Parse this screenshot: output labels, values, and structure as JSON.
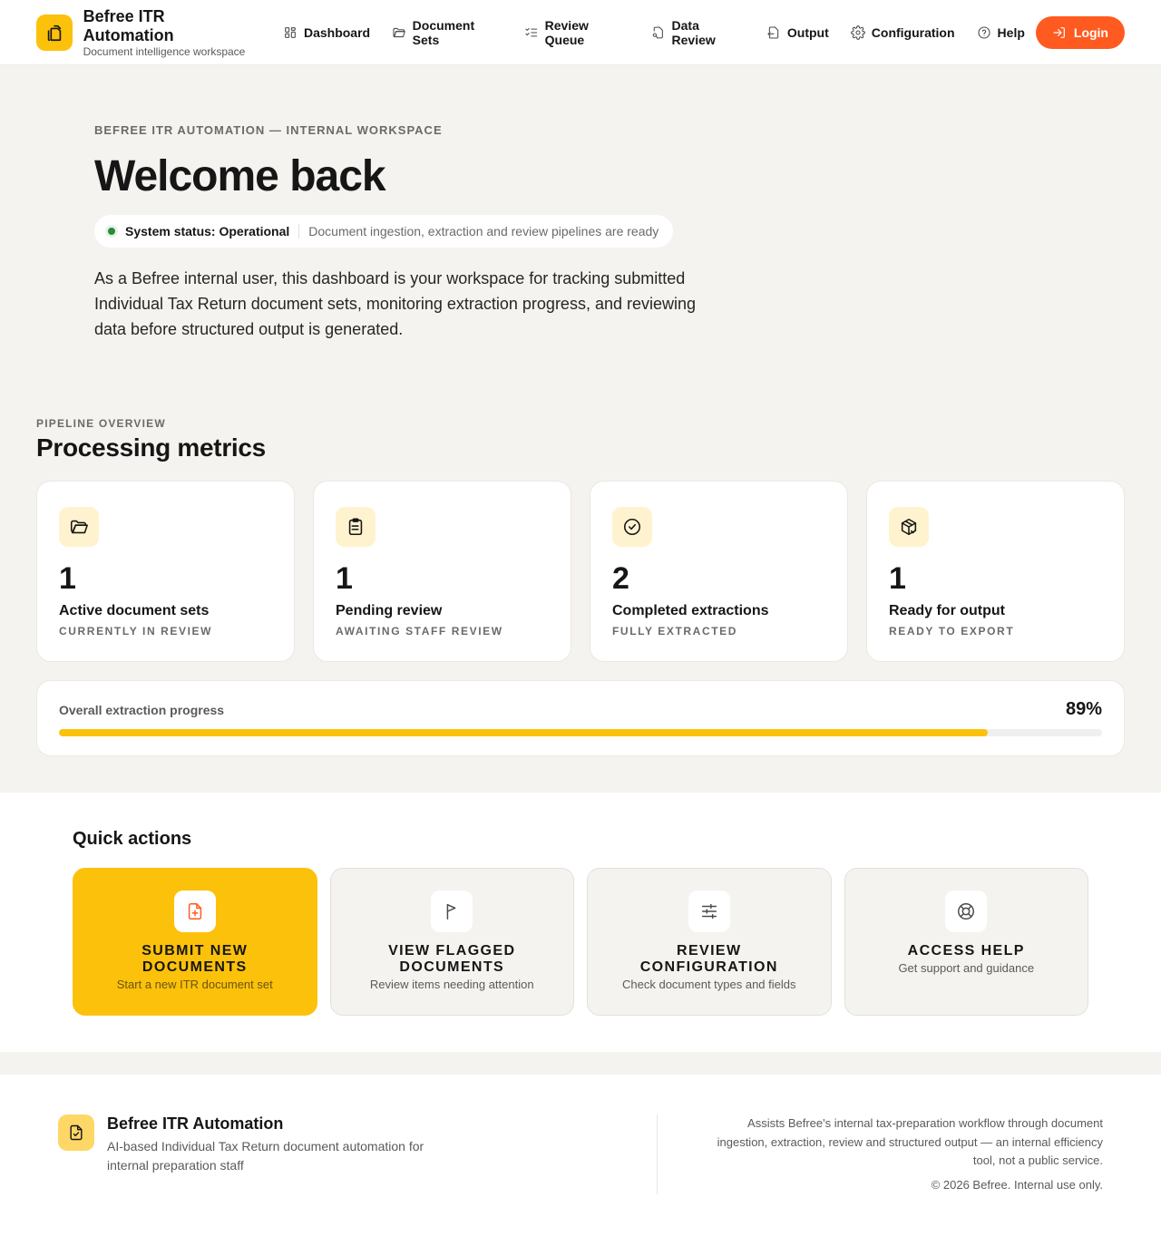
{
  "header": {
    "brand_title": "Befree ITR Automation",
    "brand_subtitle": "Document intelligence workspace",
    "nav": [
      {
        "label": "Dashboard",
        "icon": "dashboard-icon"
      },
      {
        "label": "Document Sets",
        "icon": "folder-icon"
      },
      {
        "label": "Review Queue",
        "icon": "list-check-icon"
      },
      {
        "label": "Data Review",
        "icon": "file-search-icon"
      },
      {
        "label": "Output",
        "icon": "file-export-icon"
      },
      {
        "label": "Configuration",
        "icon": "gear-icon"
      },
      {
        "label": "Help",
        "icon": "help-circle-icon"
      }
    ],
    "login_label": "Login"
  },
  "hero": {
    "eyebrow": "BEFREE ITR AUTOMATION — INTERNAL WORKSPACE",
    "title": "Welcome back",
    "status_label": "System status: Operational",
    "status_description": "Document ingestion, extraction and review pipelines are ready",
    "description": "As a Befree internal user, this dashboard is your workspace for tracking submitted Individual Tax Return document sets, monitoring extraction progress, and reviewing data before structured output is generated."
  },
  "metrics_section": {
    "eyebrow": "PIPELINE OVERVIEW",
    "title": "Processing metrics",
    "cards": [
      {
        "value": "1",
        "label": "Active document sets",
        "sublabel": "CURRENTLY IN REVIEW",
        "icon": "folder-open-icon"
      },
      {
        "value": "1",
        "label": "Pending review",
        "sublabel": "AWAITING STAFF REVIEW",
        "icon": "clipboard-icon"
      },
      {
        "value": "2",
        "label": "Completed extractions",
        "sublabel": "FULLY EXTRACTED",
        "icon": "check-circle-icon"
      },
      {
        "value": "1",
        "label": "Ready for output",
        "sublabel": "READY TO EXPORT",
        "icon": "package-icon"
      }
    ],
    "progress": {
      "label": "Overall extraction progress",
      "value_text": "89%",
      "fraction": 0.89
    }
  },
  "quick_actions": {
    "title": "Quick actions",
    "items": [
      {
        "title": "SUBMIT NEW DOCUMENTS",
        "subtitle": "Start a new ITR document set",
        "icon": "file-plus-icon"
      },
      {
        "title": "VIEW FLAGGED DOCUMENTS",
        "subtitle": "Review items needing attention",
        "icon": "flag-icon"
      },
      {
        "title": "REVIEW CONFIGURATION",
        "subtitle": "Check document types and fields",
        "icon": "sliders-icon"
      },
      {
        "title": "ACCESS HELP",
        "subtitle": "Get support and guidance",
        "icon": "lifebuoy-icon"
      }
    ]
  },
  "footer": {
    "title": "Befree ITR Automation",
    "description": "AI-based Individual Tax Return document automation for internal preparation staff",
    "about": "Assists Befree's internal tax-preparation workflow through document ingestion, extraction, review and structured output — an internal efficiency tool, not a public service.",
    "copyright": "© 2026 Befree. Internal use only."
  },
  "colors": {
    "accent": "#fcc10a",
    "login": "#ff5a1f",
    "background_band": "#f5f3ef",
    "status_ok": "#2a8a3c"
  }
}
